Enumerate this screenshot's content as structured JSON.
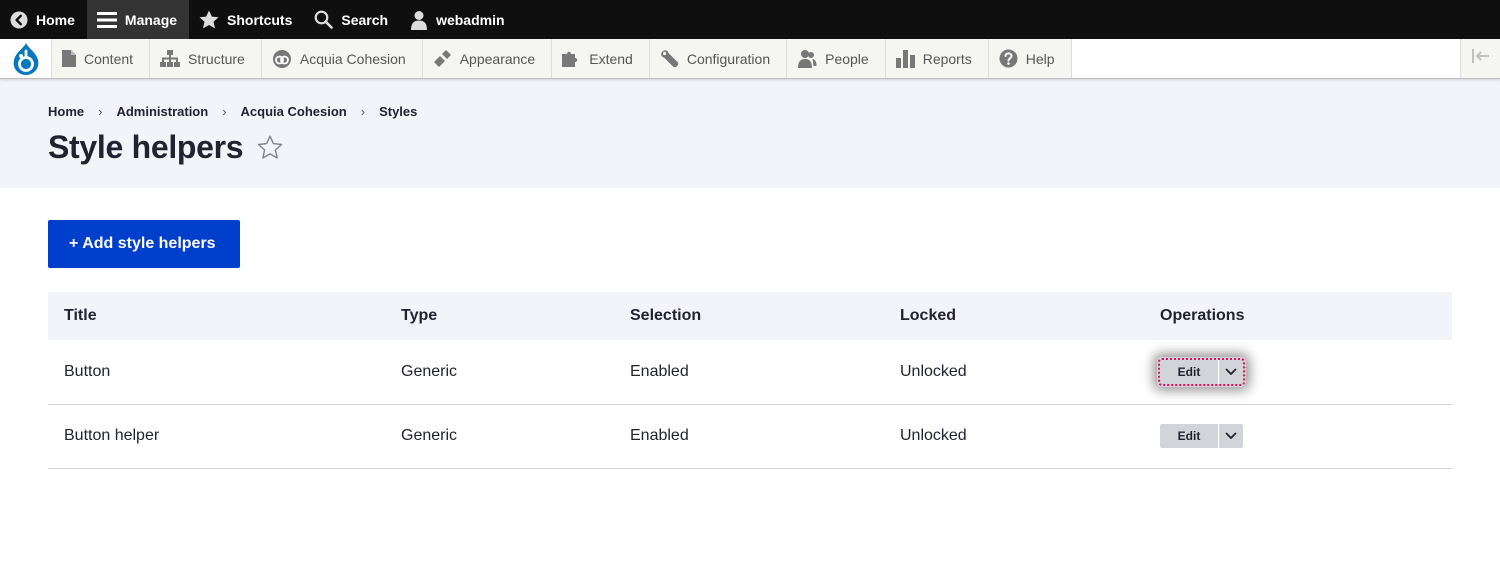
{
  "toolbar": {
    "home_label": "Home",
    "manage_label": "Manage",
    "shortcuts_label": "Shortcuts",
    "search_label": "Search",
    "user_label": "webadmin"
  },
  "tray": {
    "items": [
      {
        "label": "Content",
        "icon": "file-icon"
      },
      {
        "label": "Structure",
        "icon": "sitemap-icon"
      },
      {
        "label": "Acquia Cohesion",
        "icon": "cohesion-icon"
      },
      {
        "label": "Appearance",
        "icon": "paintbrush-icon"
      },
      {
        "label": "Extend",
        "icon": "puzzle-icon"
      },
      {
        "label": "Configuration",
        "icon": "wrench-icon"
      },
      {
        "label": "People",
        "icon": "people-icon"
      },
      {
        "label": "Reports",
        "icon": "bar-chart-icon"
      },
      {
        "label": "Help",
        "icon": "question-icon"
      }
    ]
  },
  "breadcrumb": [
    "Home",
    "Administration",
    "Acquia Cohesion",
    "Styles"
  ],
  "breadcrumb_separator": "›",
  "page_title": "Style helpers",
  "add_button_label": "+ Add style helpers",
  "table": {
    "headers": [
      "Title",
      "Type",
      "Selection",
      "Locked",
      "Operations"
    ],
    "rows": [
      {
        "title": "Button",
        "type": "Generic",
        "selection": "Enabled",
        "locked": "Unlocked",
        "operation": "Edit"
      },
      {
        "title": "Button helper",
        "type": "Generic",
        "selection": "Enabled",
        "locked": "Unlocked",
        "operation": "Edit"
      }
    ]
  },
  "colors": {
    "toolbar_bg": "#0f0f0f",
    "primary_button": "#003ecc",
    "header_bg": "#f3f4f9",
    "focus_outline": "#e0115f"
  }
}
